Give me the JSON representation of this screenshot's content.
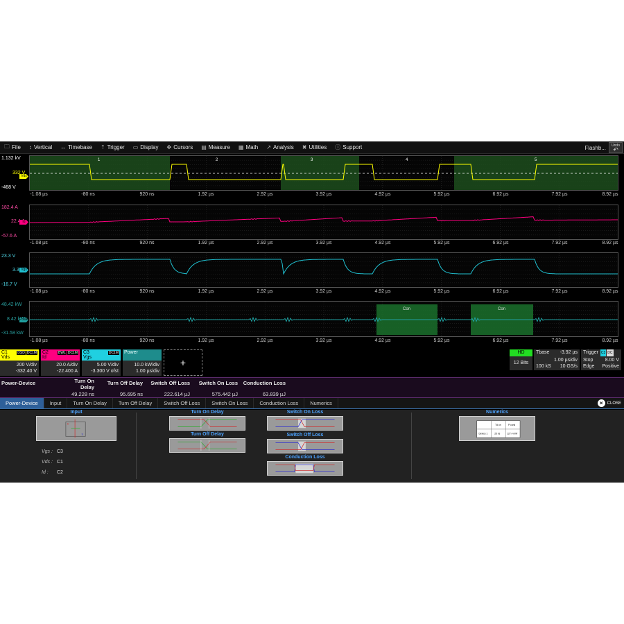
{
  "menu": {
    "items": [
      {
        "icon": "🗀",
        "label": "File"
      },
      {
        "icon": "↕",
        "label": "Vertical"
      },
      {
        "icon": "↔",
        "label": "Timebase"
      },
      {
        "icon": "⇡",
        "label": "Trigger"
      },
      {
        "icon": "▭",
        "label": "Display"
      },
      {
        "icon": "✥",
        "label": "Cursors"
      },
      {
        "icon": "▤",
        "label": "Measure"
      },
      {
        "icon": "▦",
        "label": "Math"
      },
      {
        "icon": "↗",
        "label": "Analysis"
      },
      {
        "icon": "✖",
        "label": "Utilities"
      },
      {
        "icon": "ⓘ",
        "label": "Support"
      }
    ],
    "flashback": "Flashb...",
    "undo": "Undo"
  },
  "time_axis": [
    "-1.08 µs",
    "-80 ns",
    "920 ns",
    "1.92 µs",
    "2.92 µs",
    "3.92 µs",
    "4.92 µs",
    "5.92 µs",
    "6.92 µs",
    "7.92 µs",
    "8.92 µs"
  ],
  "traces": [
    {
      "name": "vds",
      "top": "1.132 kV",
      "mid": "332 V",
      "bot": "-468 V",
      "marker": "Vds",
      "color": "#ffff00"
    },
    {
      "name": "id",
      "top": "182.4 A",
      "mid": "22.4 A",
      "bot": "-57.6 A",
      "marker": "Id",
      "color": "#ff0080"
    },
    {
      "name": "vgs",
      "top": "23.3 V",
      "mid": "3.3 V",
      "bot": "-16.7 V",
      "marker": "Vgs",
      "color": "#20c0d0"
    },
    {
      "name": "power",
      "top": "48.42 kW",
      "mid": "8.42 kW",
      "bot": "-31.58 kW",
      "marker": "Power",
      "color": "#20a0a0"
    }
  ],
  "cycle_numbers": [
    "1",
    "2",
    "3",
    "4",
    "5"
  ],
  "con_label": "Con",
  "channels": [
    {
      "id": "C1",
      "tags": [
        "DSD",
        "DC1M"
      ],
      "name": "Vds",
      "scale": "200 V/div",
      "offset": "-332.40 V",
      "color": "#ffff00"
    },
    {
      "id": "C2",
      "tags": [
        "BWL",
        "DC1M"
      ],
      "name": "Id",
      "scale": "20.0 A/div",
      "offset": "-22.400 A",
      "color": "#ff0080"
    },
    {
      "id": "C3",
      "tags": [
        "DC1M"
      ],
      "name": "Vgs",
      "scale": "5.00 V/div",
      "offset": "-3.300 V ofst",
      "color": "#20d0e0"
    },
    {
      "id": "",
      "tags": [],
      "name": "Power",
      "scale": "10.0 kW/div",
      "offset": "1.00 µs/div",
      "color": "#1e8c8c"
    }
  ],
  "add_label": "+",
  "hd": {
    "label": "HD",
    "bits": "12 Bits"
  },
  "tbase": {
    "label": "Tbase",
    "value": "-3.92 µs",
    "div": "1.00 µs/div",
    "samples": "100 kS",
    "rate": "10 GS/s"
  },
  "trigger": {
    "label": "Trigger",
    "tags": [
      "C3",
      "DC"
    ],
    "mode": "Stop",
    "level": "8.00 V",
    "type": "Edge",
    "slope": "Positive"
  },
  "measure": {
    "row_label": "Power-Device",
    "headers": [
      "Turn On Delay",
      "Turn Off Delay",
      "Switch Off Loss",
      "Switch On Loss",
      "Conduction Loss"
    ],
    "values": [
      "49.228 ns",
      "95.695 ns",
      "222.614 µJ",
      "575.442 µJ",
      "63.839 µJ"
    ]
  },
  "tabs": [
    "Power-Device",
    "Input",
    "Turn On Delay",
    "Turn Off Delay",
    "Switch Off Loss",
    "Switch On Loss",
    "Conduction Loss",
    "Numerics"
  ],
  "close_label": "CLOSE",
  "dialog": {
    "input_title": "Input",
    "sources": [
      {
        "label": "Vgs :",
        "value": "C3"
      },
      {
        "label": "Vds :",
        "value": "C1"
      },
      {
        "label": "Id :",
        "value": "C2"
      }
    ],
    "turn_on_title": "Turn On Delay",
    "turn_off_title": "Turn Off Delay",
    "switch_on_title": "Switch On Loss",
    "switch_off_title": "Switch Off Loss",
    "conduction_title": "Conduction Loss",
    "numerics_title": "Numerics",
    "numerics_table": {
      "h1": "Td on",
      "h2": "P cond",
      "r1": "Device 1",
      "v1": "25 ns",
      "v2": "127.4 mW"
    }
  }
}
